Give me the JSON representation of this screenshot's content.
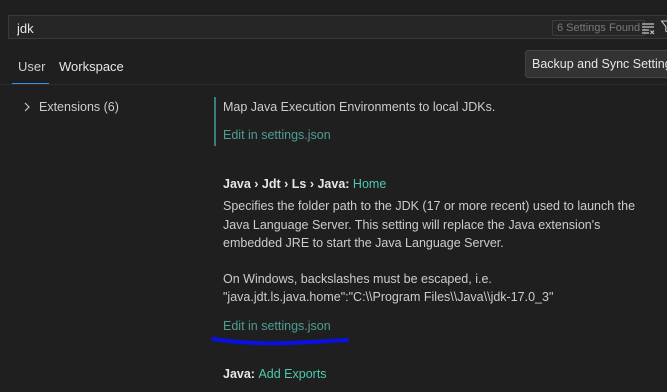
{
  "search": {
    "value": "jdk",
    "results_count": "6 Settings Found"
  },
  "tabs": {
    "user": "User",
    "workspace": "Workspace"
  },
  "sync_button": "Backup and Sync Settings",
  "toc": {
    "extensions_label": "Extensions (6)"
  },
  "settings": [
    {
      "description": "Map Java Execution Environments to local JDKs.",
      "edit_link": "Edit in settings.json"
    },
    {
      "title_prefix": "Java › Jdt › Ls › Java: ",
      "title_key": "Home",
      "description_lines": [
        "Specifies the folder path to the JDK (17 or more recent) used to launch the",
        "Java Language Server. This setting will replace the Java extension's",
        "embedded JRE to start the Java Language Server."
      ],
      "note_lines": [
        "On Windows, backslashes must be escaped, i.e.",
        "\"java.jdt.ls.java.home\":\"C:\\\\Program Files\\\\Java\\\\jdk-17.0_3\""
      ],
      "edit_link": "Edit in settings.json"
    },
    {
      "title_prefix": "Java: ",
      "title_key": "Add Exports"
    }
  ],
  "colors": {
    "background": "#1f1f1f",
    "link": "#4e9e94",
    "key": "#4ec9b0",
    "annotation": "#0a10e6"
  }
}
